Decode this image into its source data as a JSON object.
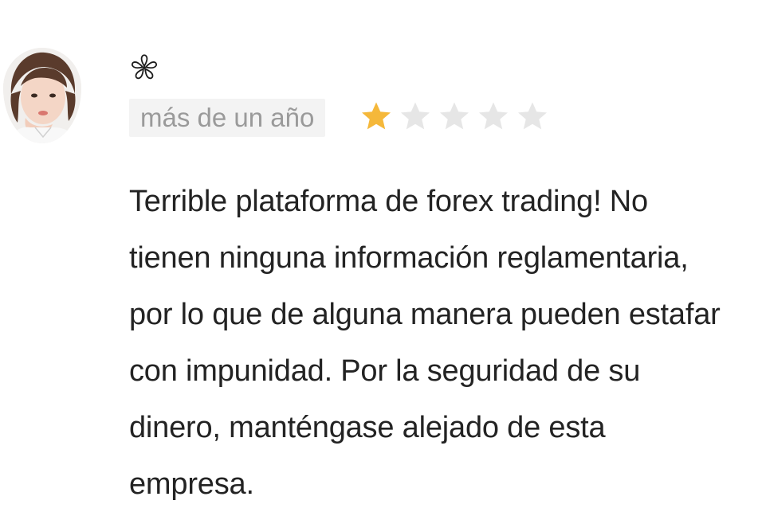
{
  "review": {
    "time_label": "más de un año",
    "rating": 1,
    "max_rating": 5,
    "star_colors": {
      "filled": "#f5b83a",
      "empty": "#e6e6e6"
    },
    "text": "Terrible plataforma de forex trading! No tienen ninguna información reglamentaria, por lo que de alguna manera pueden estafar con impunidad. Por la seguridad de su dinero, manténgase alejado de esta empresa."
  },
  "icons": {
    "avatar": "user-avatar-photo",
    "badge": "flower-outline-icon"
  }
}
